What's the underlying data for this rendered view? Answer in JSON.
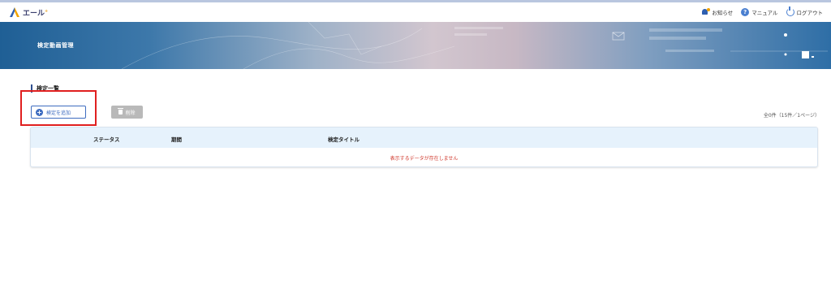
{
  "header": {
    "brand": "エール",
    "brand_sup": "+",
    "notice_label": "お知らせ",
    "manual_label": "マニュアル",
    "logout_label": "ログアウト"
  },
  "banner": {
    "title": "検定動画管理"
  },
  "section": {
    "title": "検定一覧"
  },
  "toolbar": {
    "add_label": "検定を追加",
    "delete_label": "削除",
    "count_text": "全0件（15件／1ページ）"
  },
  "table": {
    "columns": [
      "ステータス",
      "期間",
      "検定タイトル"
    ],
    "empty_message": "表示するデータが存在しません"
  },
  "colors": {
    "accent": "#3e6cc0",
    "highlight_box": "#e01f1f",
    "empty_text": "#d03a2e"
  }
}
